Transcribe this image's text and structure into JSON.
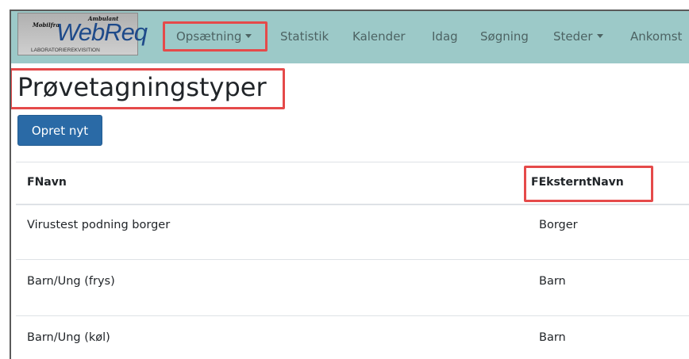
{
  "app": {
    "logo": {
      "line_top_left": "Mobilfra",
      "line_top_right": "Ambulant",
      "main": "WebReq",
      "sub": "LABORATORIEREKVISITION"
    }
  },
  "nav": {
    "items": [
      {
        "label": "Opsætning",
        "dropdown": true
      },
      {
        "label": "Statistik",
        "dropdown": false
      },
      {
        "label": "Kalender",
        "dropdown": false
      },
      {
        "label": "Idag",
        "dropdown": false
      },
      {
        "label": "Søgning",
        "dropdown": false
      },
      {
        "label": "Steder",
        "dropdown": true
      },
      {
        "label": "Ankomst",
        "dropdown": false
      }
    ]
  },
  "page": {
    "title": "Prøvetagningstyper",
    "create_button": "Opret nyt"
  },
  "table": {
    "columns": [
      "FNavn",
      "FEksterntNavn"
    ],
    "rows": [
      [
        "Virustest podning borger",
        "Borger"
      ],
      [
        "Barn/Ung (frys)",
        "Barn"
      ],
      [
        "Barn/Ung (køl)",
        "Barn"
      ]
    ]
  },
  "colors": {
    "navbar": "#9cc9c8",
    "primary_button": "#2a6aa6",
    "highlight": "#e54a4a"
  }
}
